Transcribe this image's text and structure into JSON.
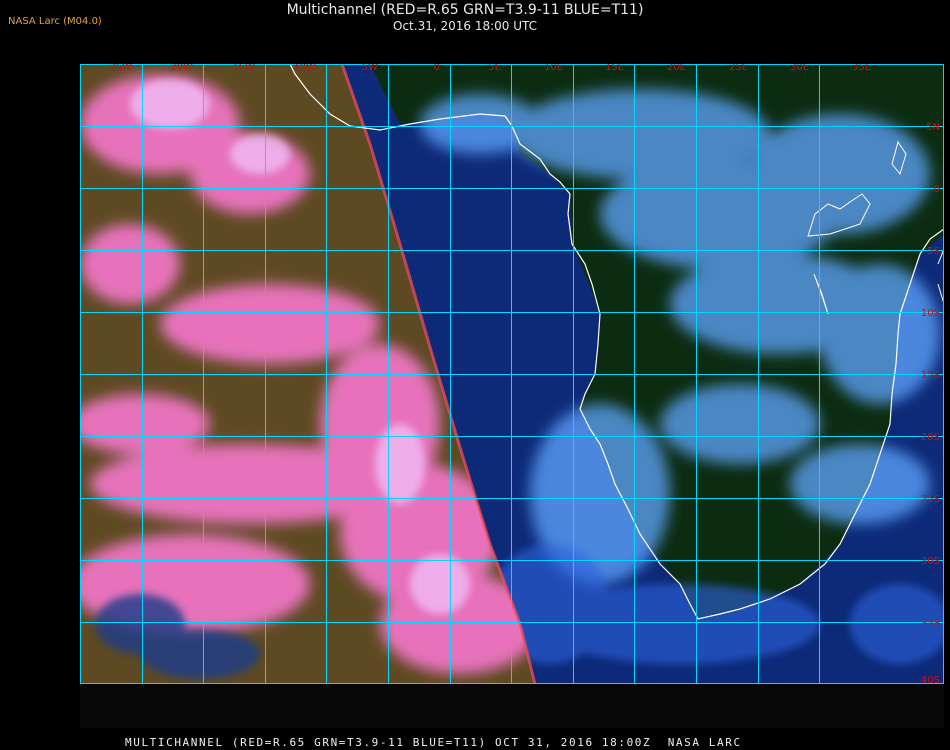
{
  "header": {
    "credit": "NASA Larc (M04.0)",
    "title": "Multichannel (RED=R.65 GRN=T3.9-11 BLUE=T11)",
    "subtitle": "Oct.31, 2016 18:00 UTC"
  },
  "map": {
    "longitude_labels": [
      "25W",
      "20W",
      "15W",
      "10W",
      "5W",
      "0",
      "5E",
      "10E",
      "15E",
      "20E",
      "25E",
      "30E",
      "35E"
    ],
    "latitude_labels": [
      "5N",
      "0",
      "5S",
      "10S",
      "15S",
      "20S",
      "25S",
      "30S",
      "35S",
      "40S"
    ],
    "colors": {
      "grid": "#00d8ff",
      "label": "#cc1010",
      "coast": "#ffffff",
      "ocean_night": "#0d2a78",
      "land_night": "#0b2a10",
      "day_side": "#6a4a2a",
      "cloud_day": "#ff7fd8",
      "cloud_night": "#6fb4ff"
    }
  },
  "footer": {
    "caption": "MULTICHANNEL (RED=R.65 GRN=T3.9-11 BLUE=T11) OCT 31, 2016 18:00Z  NASA LARC"
  }
}
